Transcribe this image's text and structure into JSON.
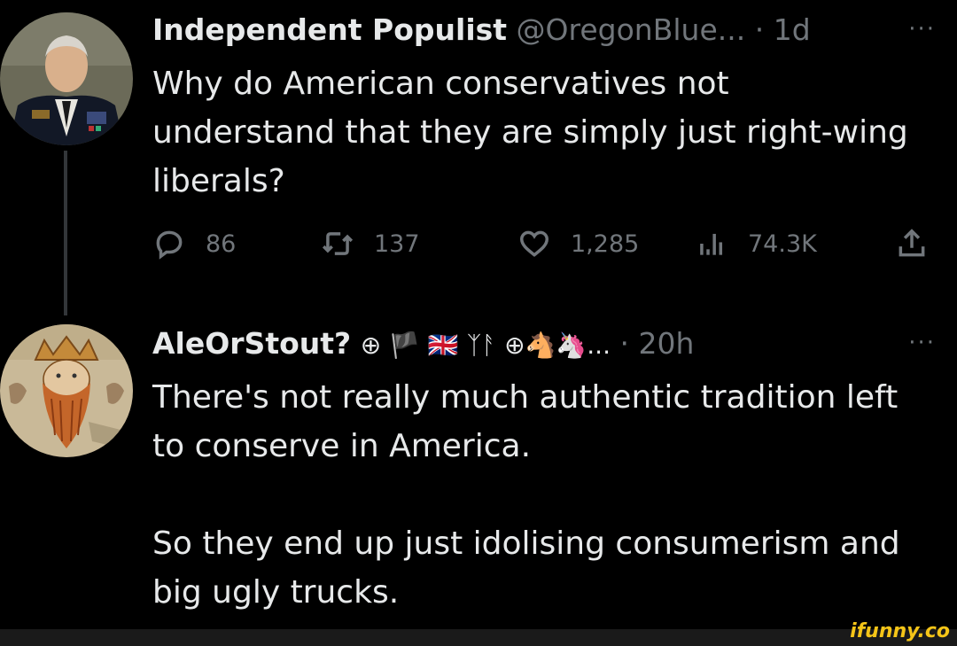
{
  "tweets": [
    {
      "name": "Independent Populist",
      "handle": "@OregonBlue...",
      "separator": "·",
      "time": "1d",
      "more": "···",
      "text": [
        "Why do American conservatives not understand that they are simply just right-wing liberals?"
      ],
      "stats": {
        "replies": "86",
        "retweets": "137",
        "likes": "1,285",
        "views": "74.3K"
      }
    },
    {
      "name": "AleOrStout?",
      "badges": "⊕ 🏴 🇬🇧 ᛉᚨ ⊕🐴🦄...",
      "separator": "·",
      "time": "20h",
      "more": "···",
      "text": [
        "There's not really much authentic tradition left to conserve in America.",
        "So they end up just idolising consumerism and big ugly trucks."
      ]
    }
  ],
  "watermark": "ifunny.co",
  "colors": {
    "background": "#000000",
    "text": "#e7e9ea",
    "secondary": "#71767b",
    "watermark": "#f5c518"
  },
  "icons": [
    "reply-icon",
    "retweet-icon",
    "like-icon",
    "views-icon",
    "share-icon"
  ]
}
